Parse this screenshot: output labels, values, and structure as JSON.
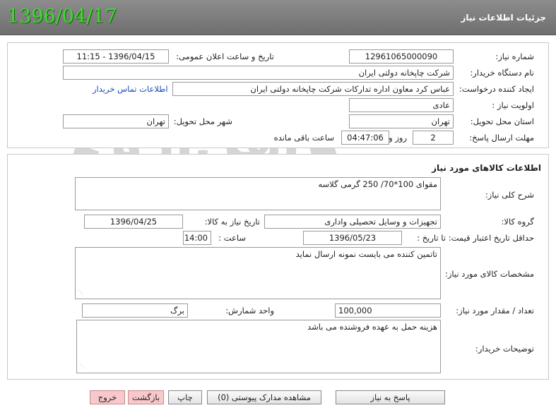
{
  "header": {
    "date": "1396/04/17",
    "title": "جزئیات اطلاعات نیاز"
  },
  "info": {
    "need_number_label": "شماره نیاز:",
    "need_number": "1296106500009‪0",
    "announce_label": "تاریخ و ساعت اعلان عمومی:",
    "announce_value": "1396/04/15 - 11:15",
    "buyer_org_label": "نام دستگاه خریدار:",
    "buyer_org": "شرکت چاپخانه دولتی ایران",
    "creator_label": "ایجاد کننده درخواست:",
    "creator": "عباس کرد معاون اداره تدارکات شرکت چاپخانه دولتی ایران",
    "contact_link": "اطلاعات تماس خریدار",
    "priority_label": "اولویت نیاز :",
    "priority": "عادی",
    "province_label": "استان محل تحویل:",
    "province": "تهران",
    "city_label": "شهر محل تحویل:",
    "city": "تهران",
    "deadline_label": "مهلت ارسال پاسخ:",
    "deadline_days": "2",
    "deadline_days_suffix": "روز و",
    "deadline_time": "04:47:06",
    "deadline_remaining": "ساعت باقی مانده"
  },
  "goods": {
    "section_title": "اطلاعات کالاهای مورد نیاز",
    "desc_label": "شرح کلی نیاز:",
    "desc": "مقوای 100*70/ 250 گرمی گلاسه",
    "group_label": "گروه کالا:",
    "group": "تجهیزات و وسایل تحصیلی واداری",
    "need_date_label": "تاریخ نیاز به کالا:",
    "need_date": "1396/04/25",
    "min_validity_label": "حداقل تاریخ اعتبار قیمت:",
    "until_label": "تا تاریخ :",
    "until_date": "1396/05/23",
    "time_label": "ساعت :",
    "time": "14:00",
    "specs_label": "مشخصات کالای مورد نیاز:",
    "specs": "تاتمین کننده می بایست نمونه ارسال نماید",
    "qty_label": "تعداد / مقدار مورد نیاز:",
    "qty": "100,000",
    "unit_label": "واحد شمارش:",
    "unit": "برگ",
    "buyer_notes_label": "توضیحات خریدار:",
    "buyer_notes": "هزینه حمل به عهده فروشنده می باشد"
  },
  "watermark": {
    "brand": "آهن‌ارو",
    "sub1": "گستر",
    "sub2": "ارتباط"
  },
  "buttons": {
    "reply": "پاسخ به نیاز",
    "attachments": "مشاهده مدارک پیوستی (0)",
    "print": "چاپ",
    "back": "بازگشت",
    "exit": "خروج"
  }
}
